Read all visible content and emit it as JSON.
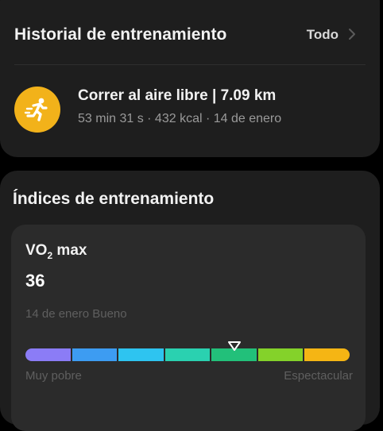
{
  "history": {
    "title": "Historial de entrenamiento",
    "view_all_label": "Todo",
    "workout": {
      "icon": "running-person-icon",
      "title": "Correr al aire libre | 7.09 km",
      "meta": "53 min 31 s · 432 kcal · 14 de enero"
    }
  },
  "indices": {
    "title": "Índices de entrenamiento",
    "vo2": {
      "name_prefix": "VO",
      "name_sub": "2",
      "name_suffix": " max",
      "value": "36",
      "status": "14 de enero Bueno",
      "scale_min_label": "Muy pobre",
      "scale_max_label": "Espectacular",
      "scale_colors": [
        "#8b7cf6",
        "#3d9cf2",
        "#2ec4f0",
        "#2ad1b0",
        "#22c07a",
        "#84d22a",
        "#f5b514"
      ],
      "marker_level_fraction": 0.645
    }
  },
  "colors": {
    "background": "#000000",
    "card": "#1e1e1e",
    "inner_card": "#2b2b2b",
    "accent": "#f2b21a"
  }
}
